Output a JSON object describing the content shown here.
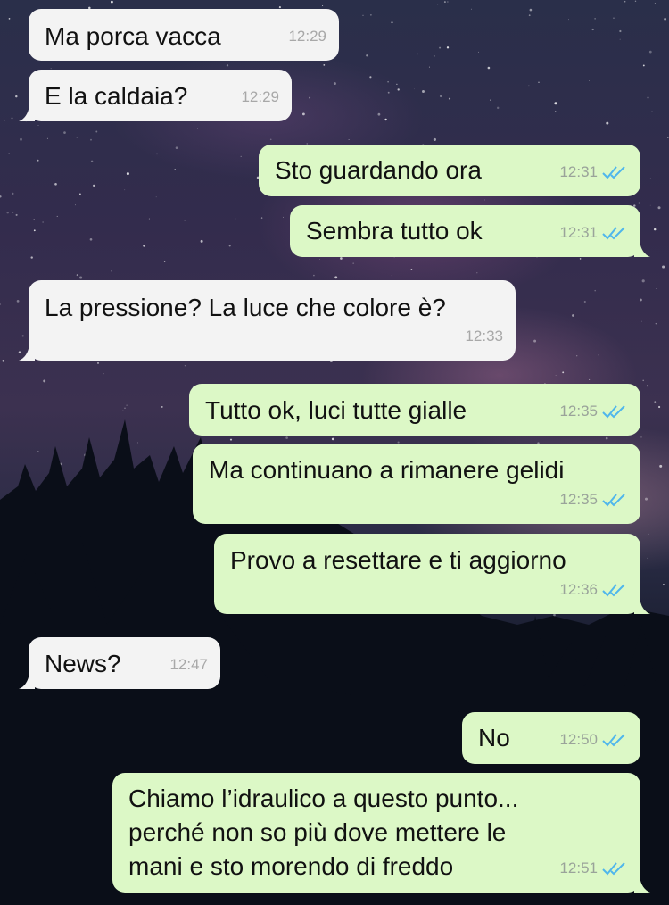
{
  "messages": [
    {
      "text": "Ma porca vacca",
      "time": "12:29",
      "direction": "in"
    },
    {
      "text": "E la caldaia?",
      "time": "12:29",
      "direction": "in"
    },
    {
      "text": "Sto guardando ora",
      "time": "12:31",
      "direction": "out",
      "status": "read"
    },
    {
      "text": "Sembra tutto ok",
      "time": "12:31",
      "direction": "out",
      "status": "read"
    },
    {
      "text": "La pressione? La luce che colore è?",
      "time": "12:33",
      "direction": "in"
    },
    {
      "text": "Tutto ok, luci tutte gialle",
      "time": "12:35",
      "direction": "out",
      "status": "read"
    },
    {
      "text": "Ma continuano a rimanere gelidi",
      "time": "12:35",
      "direction": "out",
      "status": "read"
    },
    {
      "text": "Provo a resettare e ti aggiorno",
      "time": "12:36",
      "direction": "out",
      "status": "read"
    },
    {
      "text": "News?",
      "time": "12:47",
      "direction": "in"
    },
    {
      "text": "No",
      "time": "12:50",
      "direction": "out",
      "status": "read"
    },
    {
      "lines": [
        "Chiamo l’idraulico a questo punto...",
        "perché non so più dove mettere le",
        "mani e sto morendo di freddo"
      ],
      "time": "12:51",
      "direction": "out",
      "status": "read"
    }
  ],
  "colors": {
    "incoming_bubble": "#f3f3f3",
    "outgoing_bubble": "#dcf8c6",
    "read_ticks": "#4fb6ec"
  },
  "icons": {
    "read_status": "double-check-icon"
  }
}
